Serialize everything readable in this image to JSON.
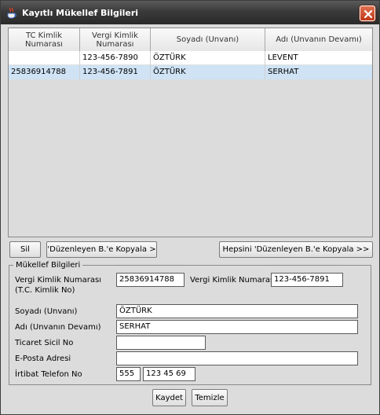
{
  "window": {
    "title": "Kayıtlı Mükellef Bilgileri",
    "icon": "java-cup-icon",
    "accent": "#c03818"
  },
  "table": {
    "columns": [
      "TC Kimlik\nNumarası",
      "Vergi Kimlik\nNumarası",
      "Soyadı (Unvanı)",
      "Adı (Unvanın Devamı)"
    ],
    "rows": [
      {
        "tc": "",
        "vkn": "123-456-7890",
        "soyad": "ÖZTÜRK",
        "ad": "LEVENT",
        "selected": false
      },
      {
        "tc": "25836914788",
        "vkn": "123-456-7891",
        "soyad": "ÖZTÜRK",
        "ad": "SERHAT",
        "selected": true
      }
    ]
  },
  "actions": {
    "delete": "Sil",
    "copy": "'Düzenleyen B.'e Kopyala  >",
    "copy_all": "Hepsini 'Düzenleyen B.'e Kopyala  >>"
  },
  "form": {
    "group_title": "Mükellef Bilgileri",
    "vkn_tc_label_1": "Vergi Kimlik Numarası",
    "vkn_tc_label_2": "(T.C. Kimlik No)",
    "vkn_tc_value": "25836914788",
    "vkn_label": "Vergi Kimlik Numarası",
    "vkn_value": "123-456-7891",
    "soyad_label": "Soyadı (Unvanı)",
    "soyad_value": "ÖZTÜRK",
    "ad_label": "Adı (Unvanın Devamı)",
    "ad_value": "SERHAT",
    "ticaret_label": "Ticaret Sicil No",
    "ticaret_value": "",
    "eposta_label": "E-Posta Adresi",
    "eposta_value": "",
    "telefon_label": "İrtibat Telefon No",
    "telefon_area": "555",
    "telefon_number": "123 45 69"
  },
  "footer": {
    "save": "Kaydet",
    "clear": "Temizle"
  }
}
